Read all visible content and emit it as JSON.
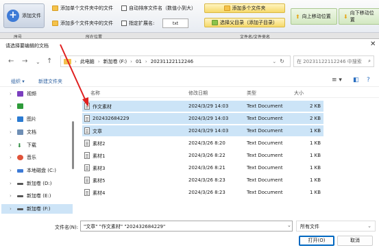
{
  "toolbar": {
    "add_file": "添加文件",
    "add_single_folder": "添加单个文件夹中的文件",
    "add_multi_folder": "添加多个文件夹中的文件",
    "auto_sort": "自动排序文件名（数值小到大）",
    "specify_ext": "指定扩展名:",
    "ext_value": "txt",
    "add_multi_folders": "添加多个文件夹",
    "select_parent": "选择父目录（添加子目录）",
    "move_up": "向上移动位置",
    "move_down": "向下移动位置"
  },
  "app_header": {
    "col_index": "序号",
    "col_location": "所在位置",
    "col_name": "文件名/文件夹名"
  },
  "dialog": {
    "title": "请选择要编辑的文档",
    "breadcrumb": [
      "此电脑",
      "新加卷 (F:)",
      "01",
      "20231122112246"
    ],
    "search_placeholder": "在 20231122112246 中搜索",
    "organize": "组织 ▾",
    "new_folder": "新建文件夹",
    "sidebar": [
      {
        "label": "视频",
        "icon": "video-icon",
        "color": "#7b3fbf"
      },
      {
        "label": "",
        "icon": "spreadsheet-icon",
        "color": "#2e9b3a"
      },
      {
        "label": "图片",
        "icon": "pictures-icon",
        "color": "#2b7bd2"
      },
      {
        "label": "文档",
        "icon": "documents-icon",
        "color": "#6f8fb5"
      },
      {
        "label": "下载",
        "icon": "download-icon",
        "color": "#2b8a3e"
      },
      {
        "label": "音乐",
        "icon": "music-icon",
        "color": "#e0533a"
      },
      {
        "label": "本地磁盘 (C:)",
        "icon": "drive-icon",
        "color": "#3d7ad6"
      },
      {
        "label": "新加卷 (D:)",
        "icon": "drive-icon",
        "color": "#555555"
      },
      {
        "label": "新加卷 (E:)",
        "icon": "drive-icon",
        "color": "#555555"
      },
      {
        "label": "新加卷 (F:)",
        "icon": "drive-icon",
        "color": "#555555"
      }
    ],
    "columns": {
      "name": "名称",
      "date": "修改日期",
      "type": "类型",
      "size": "大小"
    },
    "files": [
      {
        "name": "作文素材",
        "date": "2024/3/29 14:03",
        "type": "Text Document",
        "size": "2 KB",
        "selected": true
      },
      {
        "name": "202432684229",
        "date": "2024/3/29 14:03",
        "type": "Text Document",
        "size": "2 KB",
        "selected": true
      },
      {
        "name": "文章",
        "date": "2024/3/29 14:03",
        "type": "Text Document",
        "size": "1 KB",
        "selected": true
      },
      {
        "name": "素材2",
        "date": "2024/3/26 8:20",
        "type": "Text Document",
        "size": "1 KB",
        "selected": false
      },
      {
        "name": "素材1",
        "date": "2024/3/26 8:22",
        "type": "Text Document",
        "size": "1 KB",
        "selected": false
      },
      {
        "name": "素材3",
        "date": "2024/3/26 8:21",
        "type": "Text Document",
        "size": "1 KB",
        "selected": false
      },
      {
        "name": "素材5",
        "date": "2024/3/26 8:23",
        "type": "Text Document",
        "size": "1 KB",
        "selected": false
      },
      {
        "name": "素材4",
        "date": "2024/3/26 8:23",
        "type": "Text Document",
        "size": "1 KB",
        "selected": false
      }
    ],
    "filename_label": "文件名(N):",
    "filename_value": "\"文章\" \"作文素材\" \"202432684229\"",
    "filetype": "所有文件",
    "open": "打开(O)",
    "cancel": "取消"
  }
}
